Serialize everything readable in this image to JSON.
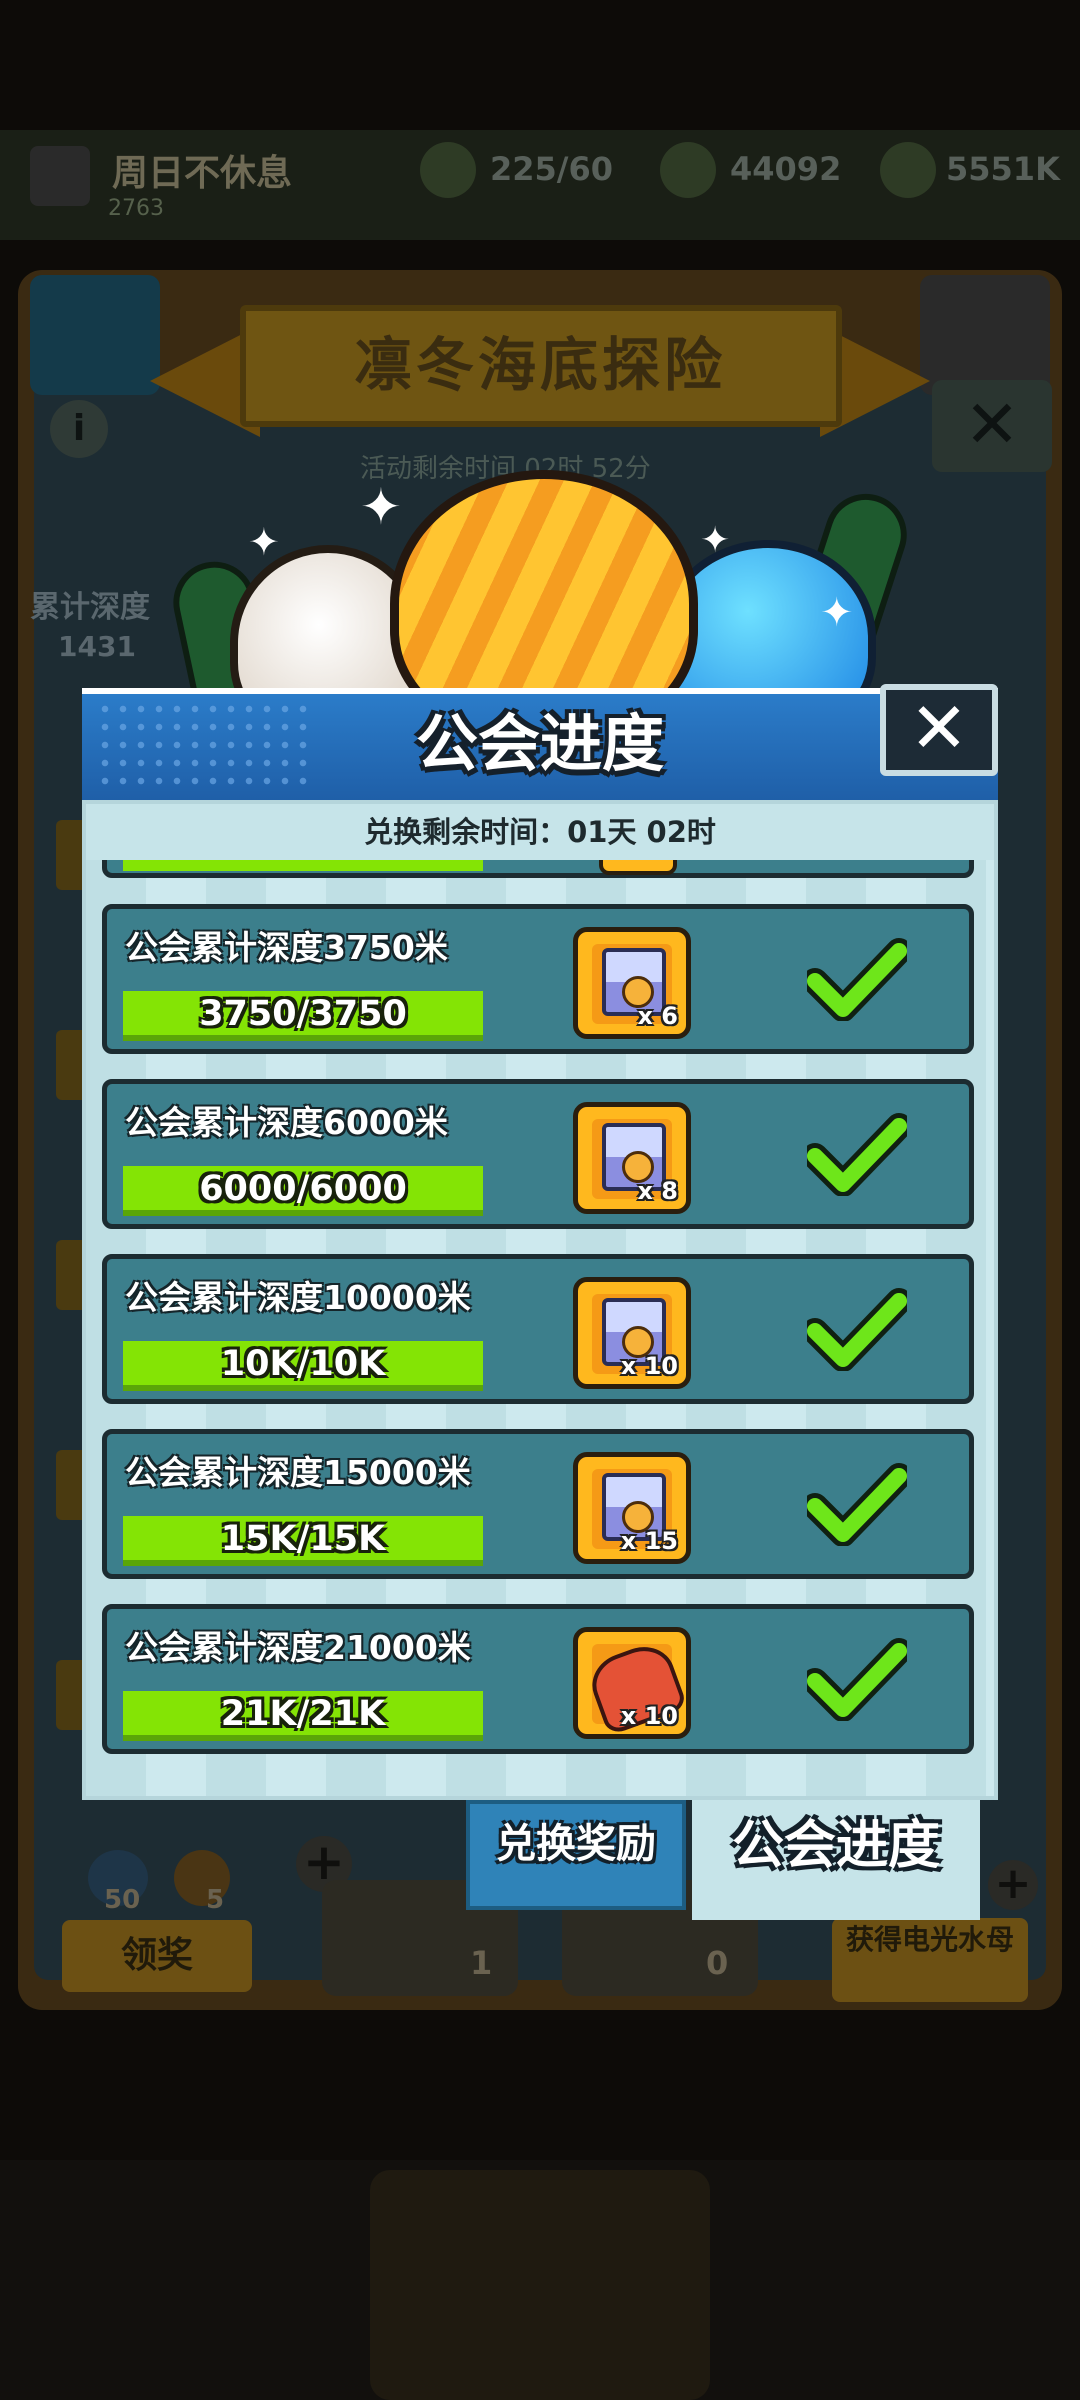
{
  "background": {
    "player_name": "周日不休息",
    "player_sub": "2763",
    "resources": [
      {
        "name": "energy",
        "value": "225/60"
      },
      {
        "name": "gems",
        "value": "44092"
      },
      {
        "name": "coins",
        "value": "5551K"
      }
    ],
    "event_title": "凛冬海底探险",
    "time_remaining": "活动剩余时间 02时 52分",
    "depth_label": "累计深度",
    "depth_value": "1431",
    "counts": {
      "left_a": "50",
      "left_b": "5",
      "item_a": "1",
      "item_b": "0"
    },
    "claim_label": "领奖",
    "get_jellyfish_label": "获得电光水母"
  },
  "dialog": {
    "title": "公会进度",
    "exchange_time": "兑换剩余时间：01天 02时",
    "tasks": [
      {
        "title": "公会累计深度3750米",
        "progress": "3750/3750",
        "reward_icon": "chest-icon",
        "reward_count": "x 6"
      },
      {
        "title": "公会累计深度6000米",
        "progress": "6000/6000",
        "reward_icon": "chest-icon",
        "reward_count": "x 8"
      },
      {
        "title": "公会累计深度10000米",
        "progress": "10K/10K",
        "reward_icon": "chest-icon",
        "reward_count": "x 10"
      },
      {
        "title": "公会累计深度15000米",
        "progress": "15K/15K",
        "reward_icon": "chest-icon",
        "reward_count": "x 15"
      },
      {
        "title": "公会累计深度21000米",
        "progress": "21K/21K",
        "reward_icon": "scroll-icon",
        "reward_count": "x 10"
      }
    ],
    "tabs": {
      "exchange": "兑换奖励",
      "guild": "公会进度"
    }
  },
  "colors": {
    "accent_blue": "#2b7cc9",
    "progress_green": "#84e405",
    "check_green": "#6ee61a",
    "reward_gold": "#ffb81e"
  }
}
